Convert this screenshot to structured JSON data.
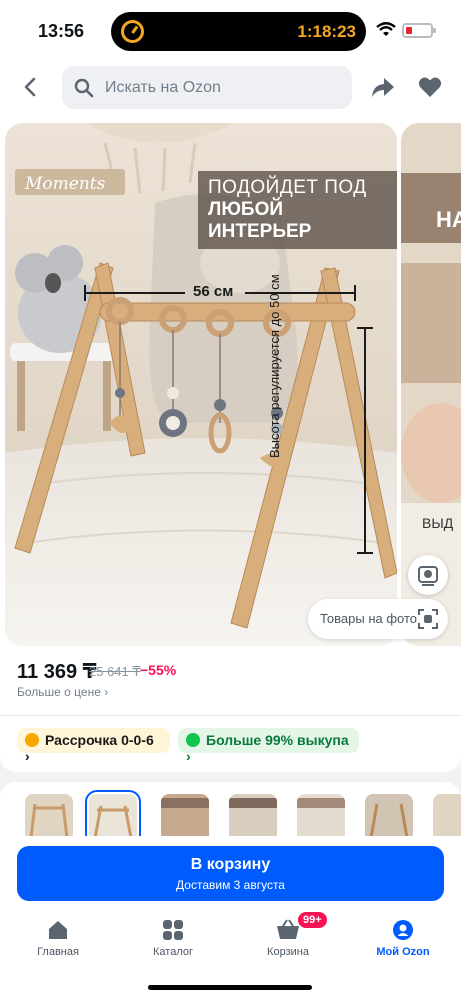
{
  "status_bar": {
    "time": "13:56",
    "timer": "1:18:23"
  },
  "header": {
    "search_placeholder": "Искать на Ozon"
  },
  "gallery": {
    "caption_line1": "ПОДОЙДЕТ ПОД",
    "caption_line2": "ЛЮБОЙ ИНТЕРЬЕР",
    "width_label": "56 см",
    "height_label": "Высота регулируется до 50 см",
    "photo2_caption": "НА",
    "photo2_text": "ВЫД",
    "goods_on_photo": "Товары на фото"
  },
  "price": {
    "current": "11 369 ₸",
    "old": "25 641 ₸",
    "discount": "−55%",
    "more_link": "Больше о цене ›"
  },
  "chips": {
    "installment": "Рассрочка 0-0-6 ›",
    "buyout": "Больше 99% выкупа ›"
  },
  "cart": {
    "label": "В корзину",
    "delivery": "Доставим 3 августа"
  },
  "tabbar": {
    "home": "Главная",
    "catalog": "Каталог",
    "cart": "Корзина",
    "cart_badge": "99+",
    "profile": "Мой Ozon"
  },
  "colors": {
    "accent": "#005bff",
    "discount": "#f91155",
    "buyout_green": "#10c44c"
  }
}
